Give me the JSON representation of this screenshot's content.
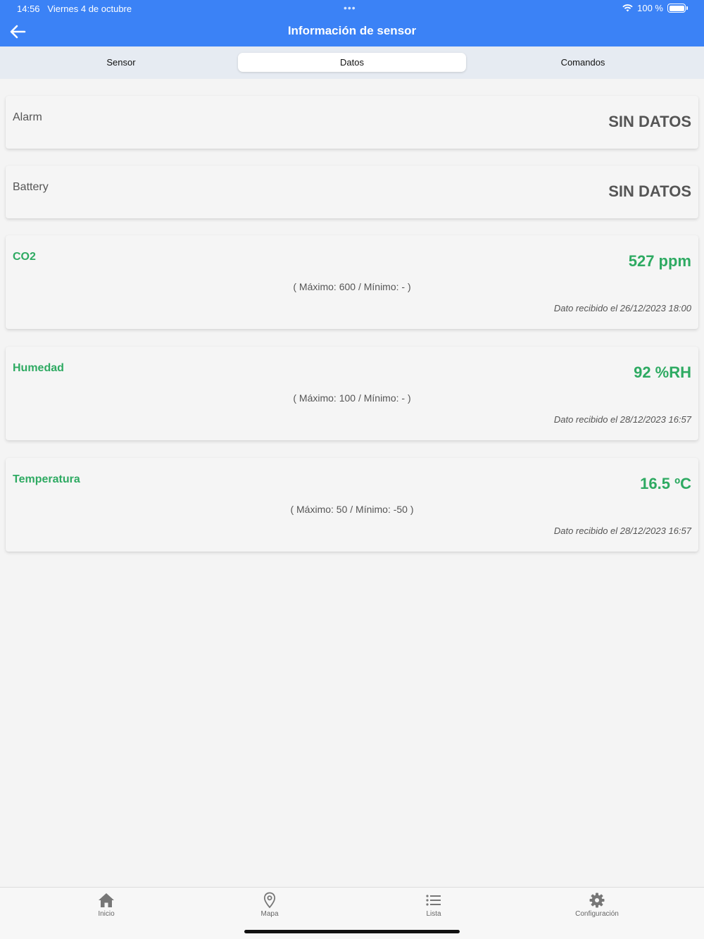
{
  "status": {
    "time": "14:56",
    "date": "Viernes 4 de octubre",
    "battery": "100 %"
  },
  "header": {
    "title": "Información de sensor"
  },
  "tabs": [
    "Sensor",
    "Datos",
    "Comandos"
  ],
  "cards": [
    {
      "label": "Alarm",
      "value": "SIN DATOS"
    },
    {
      "label": "Battery",
      "value": "SIN DATOS"
    },
    {
      "label": "CO2",
      "value": "527 ppm",
      "range": "( Máximo: 600 / Mínimo: - )",
      "date": "Dato recibido el 26/12/2023 18:00"
    },
    {
      "label": "Humedad",
      "value": "92 %RH",
      "range": "( Máximo: 100 / Mínimo: - )",
      "date": "Dato recibido el 28/12/2023 16:57"
    },
    {
      "label": "Temperatura",
      "value": "16.5 ºC",
      "range": "( Máximo: 50 / Mínimo: -50 )",
      "date": "Dato recibido el 28/12/2023 16:57"
    }
  ],
  "tabbar": [
    {
      "label": "Inicio",
      "icon": "home-icon"
    },
    {
      "label": "Mapa",
      "icon": "map-pin-icon"
    },
    {
      "label": "Lista",
      "icon": "list-icon"
    },
    {
      "label": "Configuración",
      "icon": "gear-icon"
    }
  ],
  "colors": {
    "header": "#3b82f6",
    "accent_green": "#2eaa62"
  }
}
